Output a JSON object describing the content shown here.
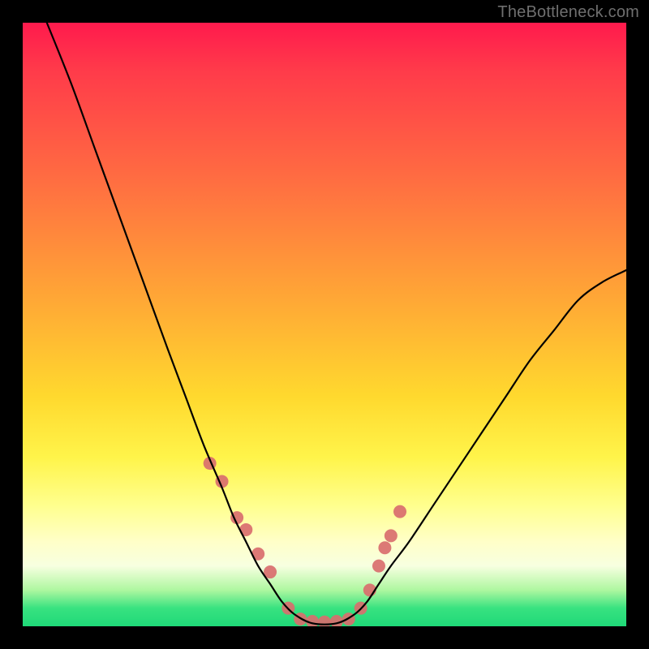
{
  "watermark": "TheBottleneck.com",
  "chart_data": {
    "type": "line",
    "title": "",
    "xlabel": "",
    "ylabel": "",
    "xlim": [
      0,
      100
    ],
    "ylim": [
      0,
      100
    ],
    "curve": {
      "name": "bottleneck-curve",
      "color": "#000000",
      "x": [
        4,
        8,
        12,
        16,
        20,
        24,
        27,
        30,
        33,
        35,
        37,
        39,
        41,
        43,
        45,
        48,
        52,
        55,
        57,
        59,
        61,
        64,
        68,
        72,
        76,
        80,
        84,
        88,
        92,
        96,
        100
      ],
      "y": [
        100,
        90,
        79,
        68,
        57,
        46,
        38,
        30,
        23,
        18,
        14,
        10,
        7,
        4,
        2,
        0.5,
        0.5,
        2,
        4,
        7,
        10,
        14,
        20,
        26,
        32,
        38,
        44,
        49,
        54,
        57,
        59
      ]
    },
    "markers": {
      "name": "sample-points",
      "color": "#d96e6e",
      "radius_px": 8,
      "x": [
        31,
        33,
        35.5,
        37,
        39,
        41,
        44,
        46,
        48,
        50,
        52,
        54,
        56,
        57.5,
        59,
        60,
        61,
        62.5
      ],
      "y": [
        27,
        24,
        18,
        16,
        12,
        9,
        3,
        1.2,
        0.8,
        0.7,
        0.8,
        1.2,
        3,
        6,
        10,
        13,
        15,
        19
      ]
    }
  }
}
